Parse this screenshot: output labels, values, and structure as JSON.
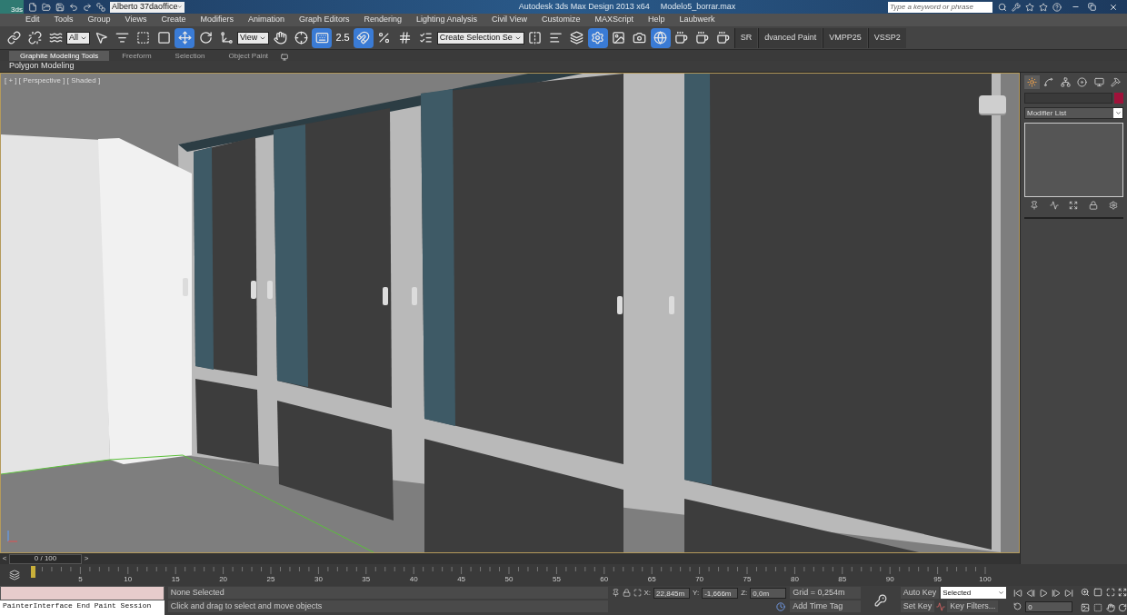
{
  "title_bar": {
    "logo_label": "3ds",
    "workspace": "Alberto 37daoffice",
    "app_title": "Autodesk 3ds Max Design 2013 x64",
    "file_name": "Modelo5_borrar.max",
    "search": {
      "placeholder": "Type a keyword or phrase"
    }
  },
  "menu": [
    "Edit",
    "Tools",
    "Group",
    "Views",
    "Create",
    "Modifiers",
    "Animation",
    "Graph Editors",
    "Rendering",
    "Lighting Analysis",
    "Civil View",
    "Customize",
    "MAXScript",
    "Help",
    "Laubwerk"
  ],
  "toolbar": [
    {
      "kind": "link",
      "selected": false
    },
    {
      "kind": "unlink",
      "selected": false
    },
    {
      "kind": "bind",
      "selected": false
    },
    {
      "kind": "dropdown",
      "value": "All"
    },
    {
      "kind": "select",
      "selected": false
    },
    {
      "kind": "select-by-name",
      "selected": false
    },
    {
      "kind": "region",
      "selected": false
    },
    {
      "kind": "crossing",
      "selected": false
    },
    {
      "kind": "move",
      "selected": true
    },
    {
      "kind": "rotate",
      "selected": false
    },
    {
      "kind": "scale",
      "selected": false
    },
    {
      "kind": "dropdown",
      "value": "View"
    },
    {
      "kind": "pivot",
      "selected": false
    },
    {
      "kind": "manipulate",
      "selected": false
    },
    {
      "kind": "keyboard",
      "selected": true
    },
    {
      "kind": "snap",
      "label": "2.5",
      "selected": false
    },
    {
      "kind": "angle-snap",
      "selected": true
    },
    {
      "kind": "percent-snap",
      "selected": false
    },
    {
      "kind": "spinner-snap",
      "selected": false
    },
    {
      "kind": "edit-selection",
      "selected": false
    },
    {
      "kind": "dropdown",
      "value": "Create Selection Se"
    },
    {
      "kind": "mirror",
      "selected": false
    },
    {
      "kind": "align",
      "selected": false
    },
    {
      "kind": "layers",
      "selected": false
    },
    {
      "kind": "render-setup",
      "selected": true
    },
    {
      "kind": "frame-window",
      "selected": false
    },
    {
      "kind": "render",
      "selected": false
    },
    {
      "kind": "environment",
      "selected": true
    },
    {
      "kind": "teapot",
      "selected": false
    },
    {
      "kind": "teapot",
      "selected": false
    },
    {
      "kind": "teapot",
      "selected": false
    },
    {
      "kind": "panel-tab",
      "label": "SR"
    },
    {
      "kind": "panel-tab",
      "label": "dvanced Paint"
    },
    {
      "kind": "panel-tab",
      "label": "VMPP25"
    },
    {
      "kind": "panel-tab",
      "label": "VSSP2"
    }
  ],
  "ribbon": {
    "tabs": [
      {
        "label": "Graphite Modeling Tools",
        "selected": true
      },
      {
        "label": "Freeform",
        "selected": false
      },
      {
        "label": "Selection",
        "selected": false
      },
      {
        "label": "Object Paint",
        "selected": false
      }
    ],
    "panel": "Polygon Modeling"
  },
  "viewport": {
    "label": "[ + ] [ Perspective ] [ Shaded ]",
    "active": true
  },
  "command_panel": {
    "tabs": [
      {
        "kind": "create",
        "selected": true
      },
      {
        "kind": "modify",
        "selected": false
      },
      {
        "kind": "hierarchy",
        "selected": false
      },
      {
        "kind": "motion",
        "selected": false
      },
      {
        "kind": "display",
        "selected": false
      },
      {
        "kind": "utilities",
        "selected": false
      }
    ],
    "modifier_list": "Modifier List"
  },
  "time_slider": {
    "prev": "<",
    "position": "0 / 100",
    "next": ">",
    "level": 0
  },
  "track_bar": {
    "ticks": [
      "5",
      "10",
      "15",
      "20",
      "25",
      "30",
      "35",
      "40",
      "45",
      "50",
      "55",
      "60",
      "65",
      "70",
      "75",
      "80",
      "85",
      "90",
      "95",
      "100"
    ]
  },
  "status": {
    "listener_output": "PainterInterface End Paint Session",
    "selection": "None Selected",
    "prompt": "Click and drag to select and move objects",
    "x_label": "X:",
    "x": "22,845m",
    "y_label": "Y:",
    "y": "-1,666m",
    "z_label": "Z:",
    "z": "0,0m",
    "grid": "Grid = 0,254m",
    "add_time_tag": "Add Time Tag",
    "auto_key": "Auto Key",
    "key_mode": "Selected",
    "set_key": "Set Key",
    "key_filters": "Key Filters...",
    "frame": "0"
  }
}
